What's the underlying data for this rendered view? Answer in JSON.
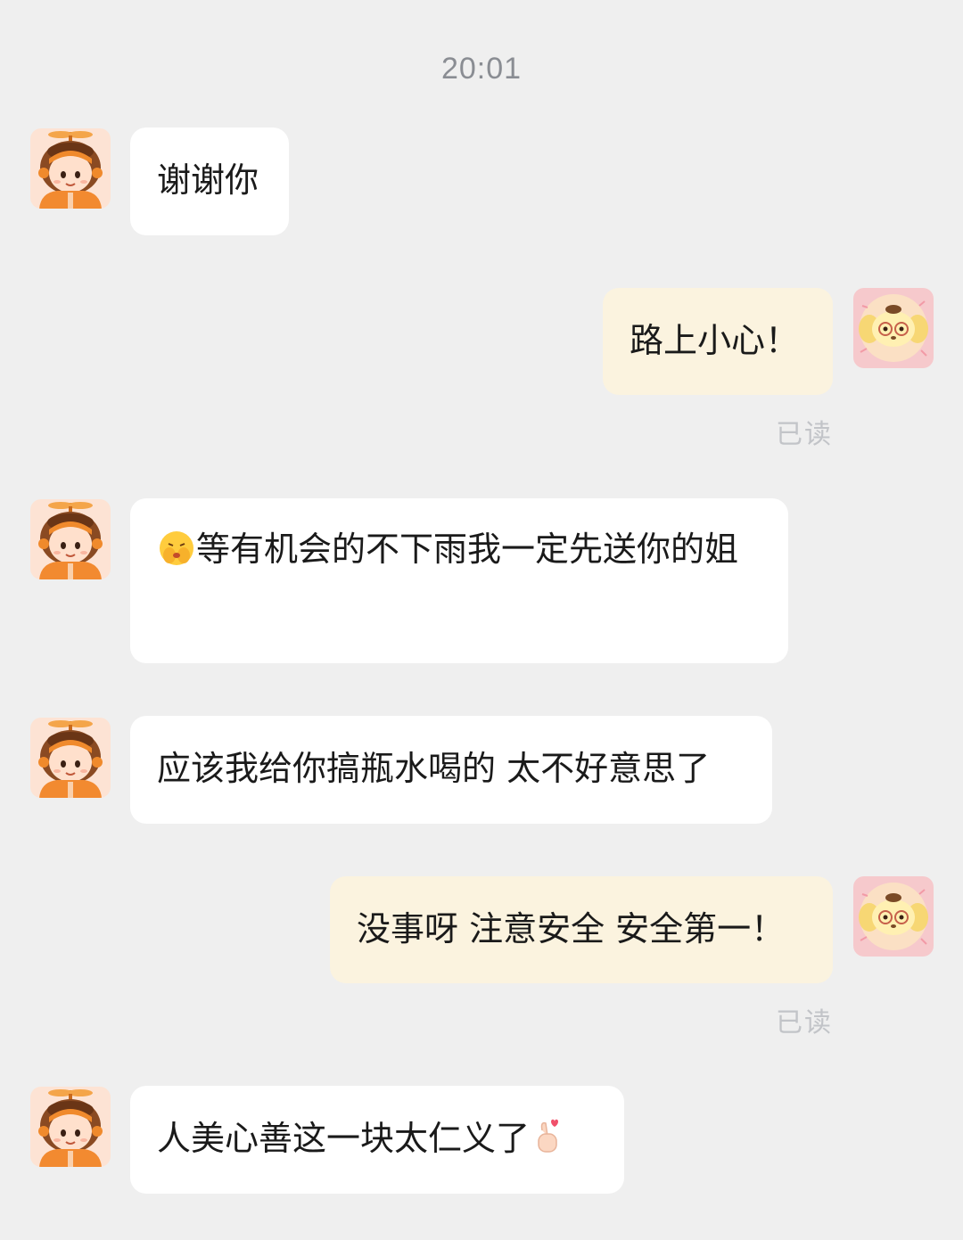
{
  "timestamp": "20:01",
  "read_label": "已读",
  "colors": {
    "background": "#efefef",
    "incoming_bubble": "#ffffff",
    "outgoing_bubble": "#fbf3df",
    "read_status": "#c2c4c8"
  },
  "icons": {
    "incoming_avatar": "courier-boy-with-propeller-helmet-icon",
    "outgoing_avatar": "yellow-puppy-with-glasses-icon",
    "emoji_1": "face-with-hands-over-mouth-emoji",
    "emoji_2": "finger-heart-emoji"
  },
  "messages": [
    {
      "sender": "other",
      "text": "谢谢你"
    },
    {
      "sender": "me",
      "text": "路上小心！",
      "status": "已读"
    },
    {
      "sender": "other",
      "text": "等有机会的不下雨我一定先送你的姐",
      "leading_emoji": "face-with-hands-over-mouth-emoji"
    },
    {
      "sender": "other",
      "text": "应该我给你搞瓶水喝的 太不好意思了"
    },
    {
      "sender": "me",
      "text": "没事呀 注意安全 安全第一！",
      "status": "已读"
    },
    {
      "sender": "other",
      "text": "人美心善这一块太仁义了",
      "trailing_emoji": "finger-heart-emoji"
    }
  ]
}
